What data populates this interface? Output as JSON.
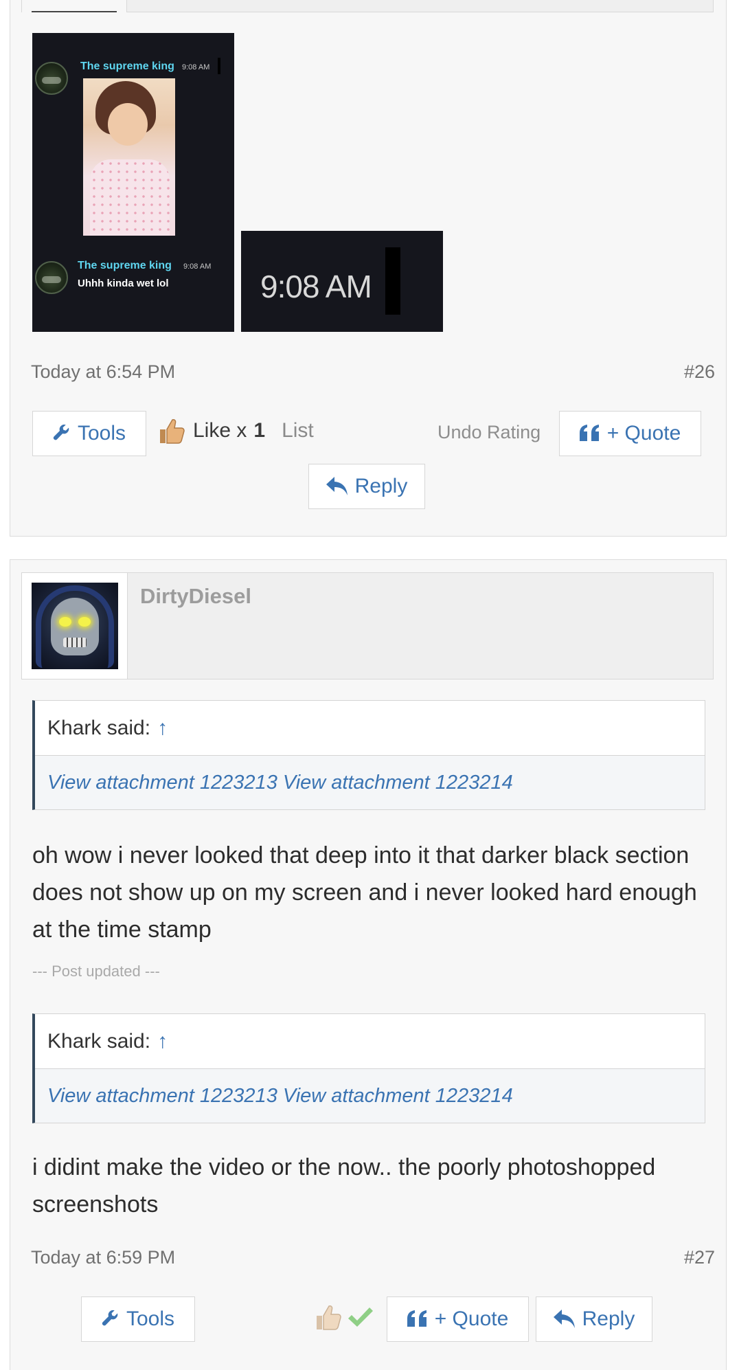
{
  "post26": {
    "attachment_1": {
      "chat": [
        {
          "name": "The supreme king",
          "time": "9:08 AM"
        },
        {
          "name": "The supreme king",
          "time": "9:08 AM",
          "message": "Uhhh kinda wet lol"
        }
      ]
    },
    "attachment_2": {
      "time": "9:08 AM"
    },
    "date": "Today at 6:54 PM",
    "number": "#26",
    "tools_label": "Tools",
    "like_text": "Like x",
    "like_count": "1",
    "list_label": "List",
    "undo_rating": "Undo Rating",
    "quote_label": "+ Quote",
    "reply_label": "Reply"
  },
  "post27": {
    "username": "DirtyDiesel",
    "quote1": {
      "author": "Khark said:",
      "arrow": "↑",
      "content": "View attachment 1223213 View attachment 1223214"
    },
    "text1": "oh wow i never looked that deep into it that darker black section does not show up on my screen and i never looked hard enough at the time stamp",
    "updated": "--- Post updated ---",
    "quote2": {
      "author": "Khark said:",
      "arrow": "↑",
      "content": "View attachment 1223213 View attachment 1223214"
    },
    "text2": "i didint make the video or the now.. the poorly photoshopped screenshots",
    "date": "Today at 6:59 PM",
    "number": "#27",
    "tools_label": "Tools",
    "quote_label": "+ Quote",
    "reply_label": "Reply"
  },
  "colors": {
    "link": "#3a73b2",
    "post_bg": "#f7f7f7",
    "quote_border": "#33485c",
    "chat_name": "#5fd6f0"
  },
  "icons": [
    "wrench-icon",
    "thumbs-up-icon",
    "quote-icon",
    "reply-arrow-icon",
    "check-icon"
  ]
}
